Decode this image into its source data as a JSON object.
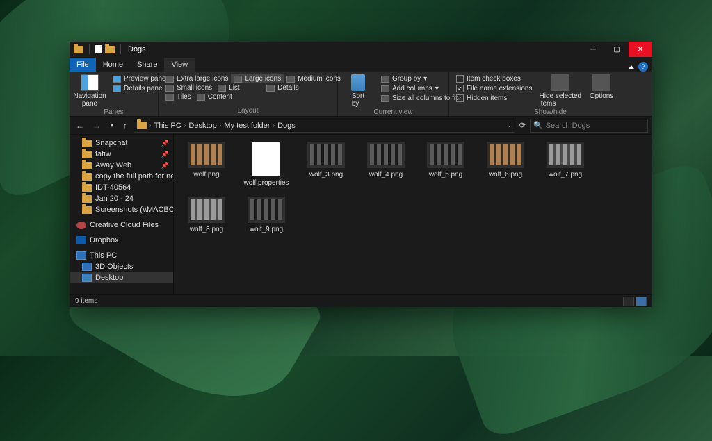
{
  "window": {
    "title": "Dogs"
  },
  "tabs": {
    "file": "File",
    "home": "Home",
    "share": "Share",
    "view": "View"
  },
  "ribbon": {
    "panes": {
      "nav": "Navigation\npane",
      "preview": "Preview pane",
      "details": "Details pane",
      "label": "Panes"
    },
    "layout": {
      "xl": "Extra large icons",
      "lg": "Large icons",
      "md": "Medium icons",
      "sm": "Small icons",
      "list": "List",
      "det": "Details",
      "tiles": "Tiles",
      "content": "Content",
      "label": "Layout"
    },
    "current": {
      "sort": "Sort\nby",
      "group": "Group by",
      "addcol": "Add columns",
      "size": "Size all columns to fit",
      "label": "Current view"
    },
    "showhide": {
      "chk": "Item check boxes",
      "ext": "File name extensions",
      "hidden": "Hidden items",
      "hide": "Hide selected\nitems",
      "options": "Options",
      "label": "Show/hide"
    }
  },
  "breadcrumb": [
    "This PC",
    "Desktop",
    "My test folder",
    "Dogs"
  ],
  "search": {
    "placeholder": "Search Dogs"
  },
  "sidebar": {
    "quick": [
      "Snapchat",
      "fatiw",
      "Away Web",
      "copy the full path for netw",
      "IDT-40564",
      "Jan 20 - 24",
      "Screenshots (\\\\MACBOOK"
    ],
    "ccf": "Creative Cloud Files",
    "dropbox": "Dropbox",
    "thispc": "This PC",
    "pcsub": [
      "3D Objects",
      "Desktop"
    ]
  },
  "files": [
    {
      "name": "wolf.png",
      "t": "brown"
    },
    {
      "name": "wolf.properties",
      "t": "doc"
    },
    {
      "name": "wolf_3.png",
      "t": "dark"
    },
    {
      "name": "wolf_4.png",
      "t": "dark"
    },
    {
      "name": "wolf_5.png",
      "t": "dark"
    },
    {
      "name": "wolf_6.png",
      "t": "brown"
    },
    {
      "name": "wolf_7.png",
      "t": "gray"
    },
    {
      "name": "wolf_8.png",
      "t": "gray"
    },
    {
      "name": "wolf_9.png",
      "t": "dark"
    }
  ],
  "status": {
    "count": "9 items"
  }
}
